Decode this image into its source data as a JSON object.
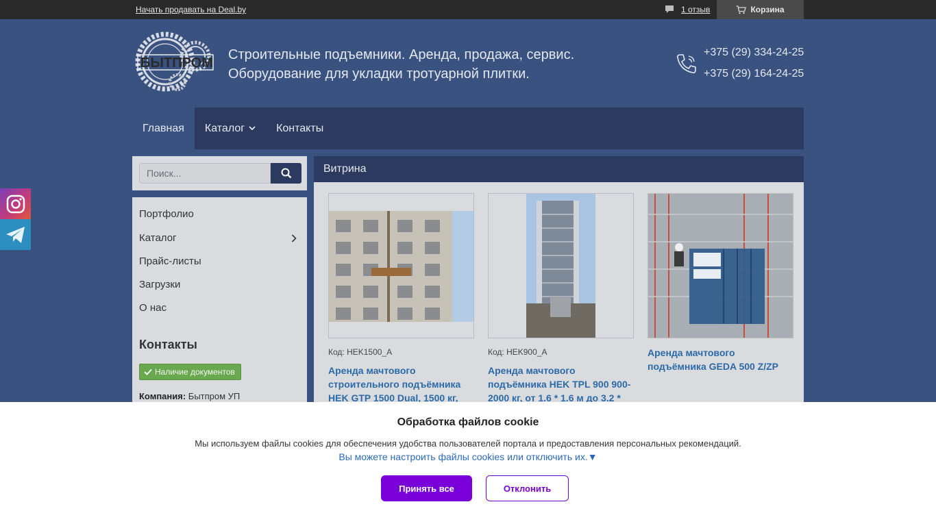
{
  "topbar": {
    "sell_link": "Начать продавать на Deal.by",
    "reviews": "1 отзыв",
    "cart": "Корзина"
  },
  "header": {
    "logo_text": "БЫТПРОМ",
    "tagline_1": "Строительные подъемники. Аренда, продажа, сервис.",
    "tagline_2": "Оборудование для укладки тротуарной плитки.",
    "phone_1": "+375 (29) 334-24-25",
    "phone_2": "+375 (29) 164-24-25"
  },
  "nav": {
    "items": [
      "Главная",
      "Каталог",
      "Контакты"
    ]
  },
  "search": {
    "placeholder": "Поиск..."
  },
  "sidebar": {
    "menu": [
      "Портфолио",
      "Каталог",
      "Прайс-листы",
      "Загрузки",
      "О нас"
    ],
    "contacts_title": "Контакты",
    "doc_badge": "Наличие документов",
    "company_label": "Компания:",
    "company_value": "Бытпром УП"
  },
  "showcase": {
    "title": "Витрина",
    "products": [
      {
        "code": "Код: HEK1500_A",
        "title_lines": [
          "Аренда мачтового",
          "строительного подъёмника",
          "HEK GTP 1500 Dual, 1500 кг,"
        ]
      },
      {
        "code": "Код: HEK900_A",
        "title_lines": [
          "Аренда мачтового",
          "подъёмника HEK TPL 900 900-",
          "2000 кг, от 1.6 * 1.6 м до 3.2 *"
        ]
      },
      {
        "code": "",
        "title_lines": [
          "Аренда мачтового",
          "подъёмника GEDA 500 Z/ZP"
        ]
      }
    ]
  },
  "cookie": {
    "title": "Обработка файлов cookie",
    "text": "Мы используем файлы cookies для обеспечения удобства пользователей портала и предоставления персональных рекомендаций.",
    "link": "Вы можете настроить файлы cookies или отключить их.▼",
    "accept": "Принять все",
    "decline": "Отклонить"
  },
  "colors": {
    "page_bg": "#3a5280",
    "nav_bg": "#2b3a5e",
    "panel_bg": "#d9dbdf",
    "link": "#2a6aa8",
    "accent_purple": "#7a00d9",
    "badge_green": "#6aa84f"
  }
}
